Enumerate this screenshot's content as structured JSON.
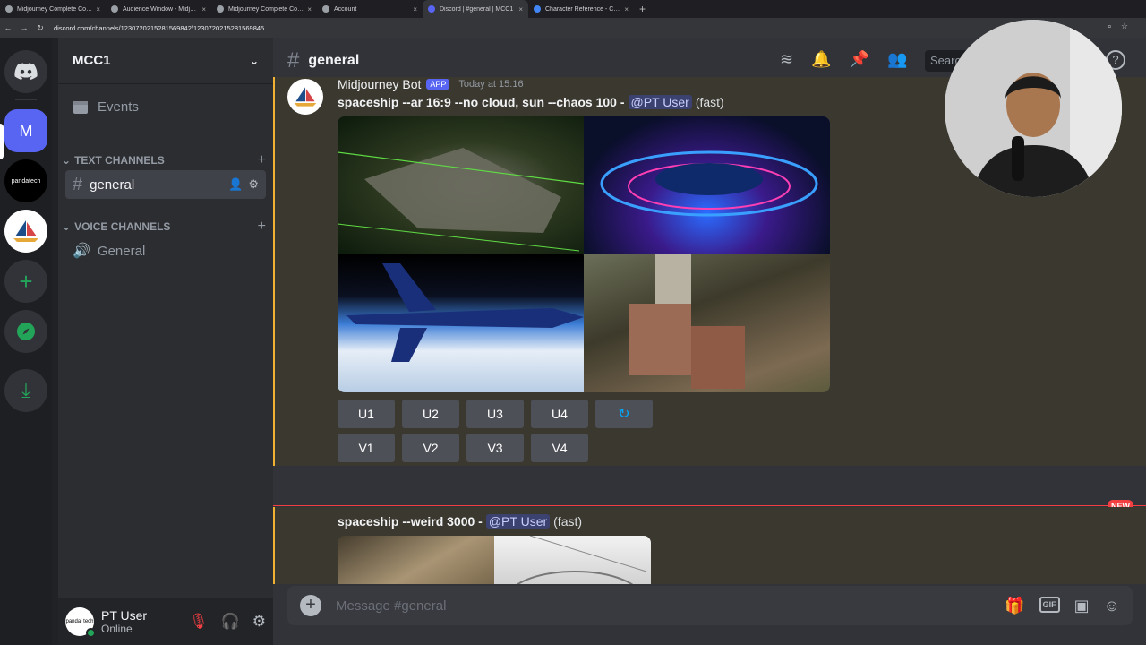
{
  "browser": {
    "tabs": [
      {
        "label": "Midjourney Complete Cours",
        "active": false
      },
      {
        "label": "Audience Window - Midjourn",
        "active": false
      },
      {
        "label": "Midjourney Complete Course",
        "active": false
      },
      {
        "label": "Account",
        "active": false
      },
      {
        "label": "Discord | #general | MCC1",
        "active": true
      },
      {
        "label": "Character Reference - Cons",
        "active": false
      }
    ],
    "url": "discord.com/channels/1230720215281569842/1230720215281569845"
  },
  "server_rail": {
    "m_label": "M",
    "panda_label": "pandatech"
  },
  "sidebar": {
    "guild_name": "MCC1",
    "events_label": "Events",
    "text_category": "TEXT CHANNELS",
    "voice_category": "VOICE CHANNELS",
    "text_channel": "general",
    "voice_channel": "General"
  },
  "user_panel": {
    "name": "PT User",
    "status": "Online",
    "avatar_text": "pandai tech"
  },
  "header": {
    "channel": "general",
    "search_placeholder": "Search"
  },
  "message1": {
    "author": "Midjourney Bot",
    "badge": "APP",
    "timestamp": "Today at 15:16",
    "prompt": "spaceship --ar 16:9 --no cloud, sun --chaos 100 -",
    "mention": "@PT User",
    "mode": "(fast)",
    "upscale_buttons": [
      "U1",
      "U2",
      "U3",
      "U4"
    ],
    "variation_buttons": [
      "V1",
      "V2",
      "V3",
      "V4"
    ],
    "reroll_icon": "↻"
  },
  "divider": {
    "new_label": "NEW"
  },
  "message2": {
    "prompt": "spaceship --weird 3000 -",
    "mention": "@PT User",
    "mode": "(fast)"
  },
  "composer": {
    "placeholder": "Message #general",
    "gif_label": "GIF"
  }
}
